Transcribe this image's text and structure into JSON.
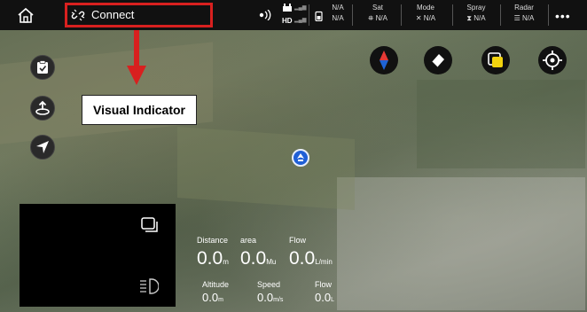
{
  "topbar": {
    "connect_label": "Connect",
    "hd_label": "HD",
    "battery_top": "N/A",
    "battery_bottom": "N/A",
    "sat": {
      "label": "Sat",
      "value": "N/A"
    },
    "mode": {
      "label": "Mode",
      "value": "N/A"
    },
    "spray": {
      "label": "Spray",
      "value": "N/A"
    },
    "radar": {
      "label": "Radar",
      "value": "N/A"
    },
    "more_label": "•••"
  },
  "annotation": {
    "label": "Visual Indicator",
    "color": "#d8201f"
  },
  "telemetry": {
    "distance": {
      "label": "Distance",
      "value": "0.0",
      "unit": "m"
    },
    "area": {
      "label": "area",
      "value": "0.0",
      "unit": "Mu"
    },
    "flow_rate": {
      "label": "Flow",
      "value": "0.0",
      "unit": "L/min"
    },
    "altitude": {
      "label": "Altitude",
      "value": "0.0",
      "unit": "m"
    },
    "speed": {
      "label": "Speed",
      "value": "0.0",
      "unit": "m/s"
    },
    "flow_total": {
      "label": "Flow",
      "value": "0.0",
      "unit": "L"
    }
  },
  "icons": {
    "home": "home-icon",
    "connect": "disconnected-link-icon",
    "task": "clipboard-check-icon",
    "takeoff": "takeoff-icon",
    "locate": "navigation-arrow-icon",
    "compass": "compass-icon",
    "eraser": "eraser-icon",
    "layers": "layers-icon",
    "target": "crosshair-icon",
    "drone": "drone-position-icon",
    "switch_view": "switch-view-icon",
    "light": "headlight-icon"
  }
}
